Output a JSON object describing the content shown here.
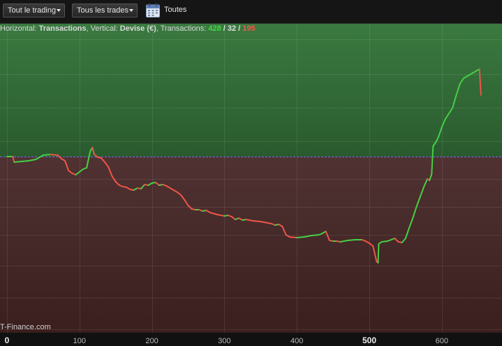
{
  "toolbar": {
    "filter1": "Tout le trading",
    "filter2": "Tous les trades",
    "period": "Toutes",
    "calendar_icon": "calendar-icon"
  },
  "info": {
    "h_label": "Horizontal: ",
    "h_value": "Transactions",
    "v_label": ", Vertical: ",
    "v_value": "Devise (€)",
    "t_label": ", Transactions: ",
    "wins": "428",
    "sep1": " / ",
    "breakeven": "32",
    "sep2": " / ",
    "losses": "195"
  },
  "watermark": "T-Finance.com",
  "colors": {
    "profit_zone": "#2f6a35",
    "loss_zone": "#4a2a29",
    "up_line": "#44d044",
    "down_line": "#ee5548",
    "baseline": "#6a6af0"
  },
  "chart_data": {
    "type": "line",
    "x_ticks": [
      0,
      100,
      200,
      300,
      400,
      500,
      600
    ],
    "x_tick_labels": [
      "0",
      "100",
      "200",
      "300",
      "400",
      "500",
      "600"
    ],
    "xlim": [
      0,
      660
    ],
    "ylim": [
      -215,
      150
    ],
    "baseline": 0,
    "grid": true,
    "points": [
      [
        0,
        0
      ],
      [
        8,
        0
      ],
      [
        10,
        -8
      ],
      [
        20,
        -7
      ],
      [
        30,
        -6
      ],
      [
        40,
        -4
      ],
      [
        50,
        2
      ],
      [
        60,
        3
      ],
      [
        70,
        2
      ],
      [
        75,
        -3
      ],
      [
        80,
        -6
      ],
      [
        85,
        -20
      ],
      [
        90,
        -24
      ],
      [
        95,
        -26
      ],
      [
        100,
        -22
      ],
      [
        105,
        -18
      ],
      [
        110,
        -16
      ],
      [
        112,
        -6
      ],
      [
        115,
        8
      ],
      [
        118,
        13
      ],
      [
        120,
        4
      ],
      [
        125,
        -1
      ],
      [
        130,
        -2
      ],
      [
        135,
        -8
      ],
      [
        140,
        -15
      ],
      [
        145,
        -28
      ],
      [
        150,
        -36
      ],
      [
        155,
        -41
      ],
      [
        160,
        -43
      ],
      [
        165,
        -44
      ],
      [
        170,
        -47
      ],
      [
        175,
        -48
      ],
      [
        180,
        -45
      ],
      [
        185,
        -46
      ],
      [
        190,
        -40
      ],
      [
        195,
        -41
      ],
      [
        200,
        -38
      ],
      [
        205,
        -37
      ],
      [
        210,
        -41
      ],
      [
        215,
        -40
      ],
      [
        220,
        -42
      ],
      [
        225,
        -45
      ],
      [
        230,
        -48
      ],
      [
        235,
        -51
      ],
      [
        240,
        -55
      ],
      [
        245,
        -62
      ],
      [
        250,
        -70
      ],
      [
        255,
        -75
      ],
      [
        260,
        -76
      ],
      [
        265,
        -76
      ],
      [
        270,
        -78
      ],
      [
        275,
        -77
      ],
      [
        280,
        -80
      ],
      [
        290,
        -83
      ],
      [
        300,
        -85
      ],
      [
        305,
        -84
      ],
      [
        310,
        -86
      ],
      [
        315,
        -90
      ],
      [
        320,
        -88
      ],
      [
        325,
        -91
      ],
      [
        330,
        -90
      ],
      [
        340,
        -92
      ],
      [
        350,
        -93
      ],
      [
        360,
        -95
      ],
      [
        365,
        -96
      ],
      [
        370,
        -98
      ],
      [
        375,
        -97
      ],
      [
        380,
        -100
      ],
      [
        385,
        -112
      ],
      [
        390,
        -115
      ],
      [
        400,
        -116
      ],
      [
        410,
        -115
      ],
      [
        420,
        -113
      ],
      [
        430,
        -112
      ],
      [
        435,
        -110
      ],
      [
        440,
        -107
      ],
      [
        445,
        -120
      ],
      [
        450,
        -121
      ],
      [
        455,
        -121
      ],
      [
        460,
        -122
      ],
      [
        470,
        -120
      ],
      [
        480,
        -119
      ],
      [
        490,
        -119
      ],
      [
        495,
        -121
      ],
      [
        500,
        -124
      ],
      [
        505,
        -128
      ],
      [
        510,
        -150
      ],
      [
        512,
        -152
      ],
      [
        513,
        -125
      ],
      [
        517,
        -122
      ],
      [
        525,
        -121
      ],
      [
        530,
        -119
      ],
      [
        535,
        -117
      ],
      [
        540,
        -122
      ],
      [
        545,
        -123
      ],
      [
        550,
        -117
      ],
      [
        555,
        -102
      ],
      [
        560,
        -88
      ],
      [
        565,
        -72
      ],
      [
        570,
        -58
      ],
      [
        575,
        -44
      ],
      [
        580,
        -32
      ],
      [
        583,
        -34
      ],
      [
        586,
        -25
      ],
      [
        588,
        15
      ],
      [
        592,
        21
      ],
      [
        595,
        27
      ],
      [
        600,
        42
      ],
      [
        605,
        54
      ],
      [
        610,
        62
      ],
      [
        615,
        70
      ],
      [
        620,
        88
      ],
      [
        625,
        104
      ],
      [
        630,
        112
      ],
      [
        635,
        115
      ],
      [
        640,
        118
      ],
      [
        645,
        121
      ],
      [
        650,
        124
      ],
      [
        652,
        125
      ],
      [
        654,
        88
      ]
    ]
  }
}
